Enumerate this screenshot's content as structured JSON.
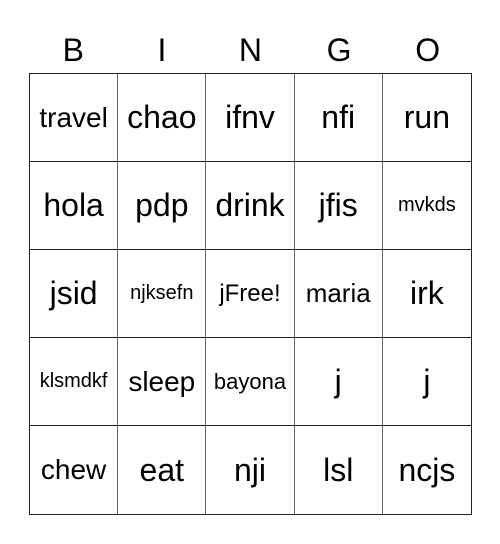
{
  "header": {
    "letters": [
      "B",
      "I",
      "N",
      "G",
      "O"
    ]
  },
  "cells": [
    "travel",
    "chao",
    "ifnv",
    "nfi",
    "run",
    "hola",
    "pdp",
    "drink",
    "jfis",
    "mvkds",
    "jsid",
    "njksefn",
    "jFree!",
    "maria",
    "irk",
    "klsmdkf",
    "sleep",
    "bayona",
    "j",
    "j",
    "chew",
    "eat",
    "nji",
    "lsl",
    "ncjs"
  ]
}
